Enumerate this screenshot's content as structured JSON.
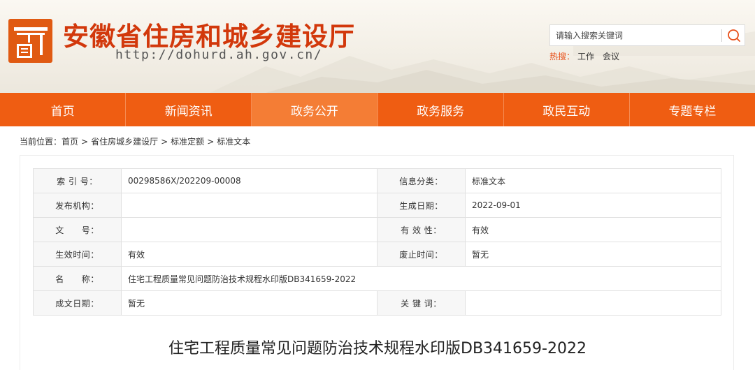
{
  "header": {
    "logo_name": "site-logo",
    "title": "安徽省住房和城乡建设厅",
    "url": "http://dohurd.ah.gov.cn/",
    "search_placeholder": "请输入搜索关键词",
    "hot_label": "热搜：",
    "hot_items": [
      "工作",
      "会议"
    ],
    "brand_color": "#d2380b"
  },
  "nav": {
    "items": [
      "首页",
      "新闻资讯",
      "政务公开",
      "政务服务",
      "政民互动",
      "专题专栏"
    ],
    "active_index": 2,
    "color": "#ef5d12"
  },
  "breadcrumb": {
    "prefix": "当前位置：",
    "items": [
      "首页",
      "省住房城乡建设厅",
      "标准定额",
      "标准文本"
    ],
    "separator": ">"
  },
  "meta": {
    "rows": [
      [
        {
          "label": "索 引 号：",
          "value": "00298586X/202209-00008"
        },
        {
          "label": "信息分类：",
          "value": "标准文本"
        }
      ],
      [
        {
          "label": "发布机构：",
          "value": ""
        },
        {
          "label": "生成日期：",
          "value": "2022-09-01"
        }
      ],
      [
        {
          "label": "文　　号：",
          "value": ""
        },
        {
          "label": "有 效 性：",
          "value": "有效"
        }
      ],
      [
        {
          "label": "生效时间：",
          "value": "有效"
        },
        {
          "label": "废止时间：",
          "value": "暂无"
        }
      ],
      [
        {
          "label": "名　　称：",
          "value": "住宅工程质量常见问题防治技术规程水印版DB341659-2022"
        }
      ],
      [
        {
          "label": "成文日期：",
          "value": "暂无"
        },
        {
          "label": "关 键 词：",
          "value": ""
        }
      ]
    ]
  },
  "document": {
    "title": "住宅工程质量常见问题防治技术规程水印版DB341659-2022"
  }
}
